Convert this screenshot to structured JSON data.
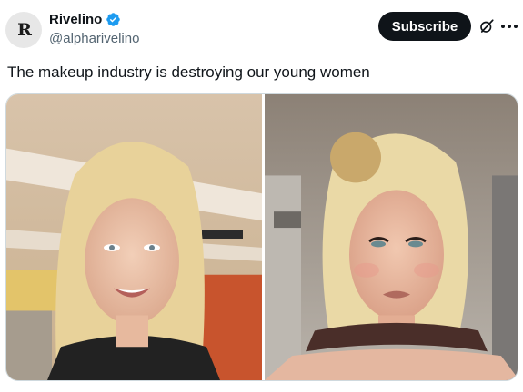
{
  "author": {
    "avatar_letter": "R",
    "display_name": "Rivelino",
    "handle": "@alpharivelino",
    "verified": true
  },
  "actions": {
    "subscribe_label": "Subscribe",
    "grok_icon": "grok-icon",
    "more_icon": "more-options-icon"
  },
  "tweet": {
    "text": "The makeup industry is destroying our young women"
  },
  "media": {
    "images": [
      "photo-without-makeup",
      "photo-with-makeup"
    ]
  },
  "colors": {
    "text": "#0f1419",
    "secondary": "#536471",
    "verified": "#1d9bf0"
  }
}
